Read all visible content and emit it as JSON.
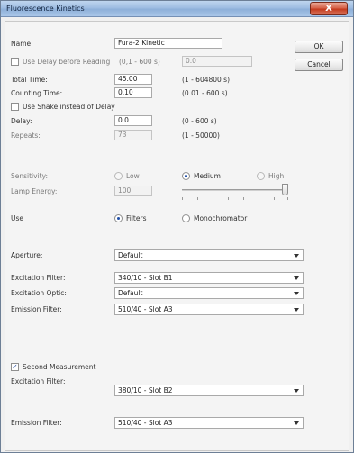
{
  "window": {
    "title": "Fluorescence Kinetics",
    "close_label": "X"
  },
  "buttons": {
    "ok": "OK",
    "cancel": "Cancel"
  },
  "name": {
    "label": "Name:",
    "value": "Fura-2 Kinetic"
  },
  "use_delay": {
    "label": "Use Delay before Reading",
    "range": "(0,1 - 600 s)",
    "value": "0.0",
    "checked": false
  },
  "total_time": {
    "label": "Total Time:",
    "value": "45.00",
    "range": "(1 - 604800 s)"
  },
  "counting_time": {
    "label": "Counting Time:",
    "value": "0.10",
    "range": "(0.01 - 600 s)"
  },
  "use_shake": {
    "label": "Use Shake instead of Delay",
    "checked": false
  },
  "delay": {
    "label": "Delay:",
    "value": "0.0",
    "range": "(0 - 600 s)"
  },
  "repeats": {
    "label": "Repeats:",
    "value": "73",
    "range": "(1 - 50000)"
  },
  "sensitivity": {
    "label": "Sensitivity:",
    "options": [
      "Low",
      "Medium",
      "High"
    ],
    "selected": "Medium"
  },
  "lamp_energy": {
    "label": "Lamp Energy:",
    "value": "100",
    "slider_level": 1.0
  },
  "use": {
    "label": "Use",
    "options": [
      "Filters",
      "Monochromator"
    ],
    "selected": "Filters"
  },
  "aperture": {
    "label": "Aperture:",
    "value": "Default"
  },
  "excitation_filter": {
    "label": "Excitation Filter:",
    "value": "340/10 - Slot B1"
  },
  "excitation_optic": {
    "label": "Excitation Optic:",
    "value": "Default"
  },
  "emission_filter": {
    "label": "Emission Filter:",
    "value": "510/40 - Slot A3"
  },
  "second_measurement": {
    "label": "Second Measurement",
    "checked": true,
    "check_glyph": "✓",
    "excitation_filter": {
      "label": "Excitation Filter:",
      "value": "380/10 - Slot B2"
    },
    "emission_filter": {
      "label": "Emission Filter:",
      "value": "510/40 - Slot A3"
    }
  }
}
